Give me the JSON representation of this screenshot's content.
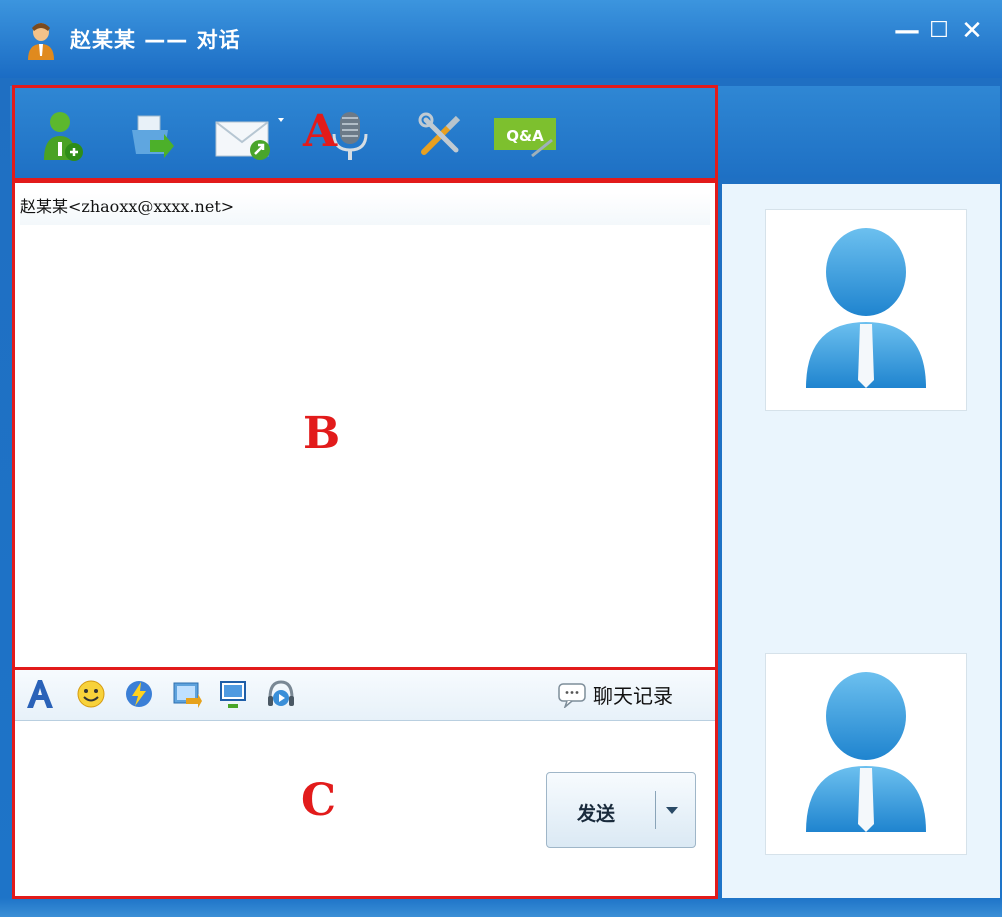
{
  "window": {
    "title": "赵某某 —— 对话",
    "buttons": {
      "minimize": "—",
      "maximize": "☐",
      "close": "✕"
    }
  },
  "toolbar": {
    "tools": [
      {
        "icon": "add-contact-icon"
      },
      {
        "icon": "send-file-icon"
      },
      {
        "icon": "send-mail-icon"
      },
      {
        "icon": "voice-microphone-icon"
      },
      {
        "icon": "settings-tools-icon"
      },
      {
        "icon": "qa-help-icon",
        "label": "Q&A"
      }
    ]
  },
  "chat": {
    "contact_line": "赵某某<zhaoxx@xxxx.net>"
  },
  "input_toolbar": {
    "icons": [
      "font-icon",
      "emoticon-icon",
      "nudge-icon",
      "send-image-icon",
      "screen-share-icon",
      "audio-headset-icon"
    ],
    "history_label": "聊天记录"
  },
  "send_button": {
    "label": "发送"
  },
  "annotations": {
    "a": "A",
    "b": "B",
    "c": "C"
  },
  "colors": {
    "title_blue": "#1f6fc2",
    "highlight_red": "#e21b1b",
    "side_panel": "#eaf5fd"
  }
}
